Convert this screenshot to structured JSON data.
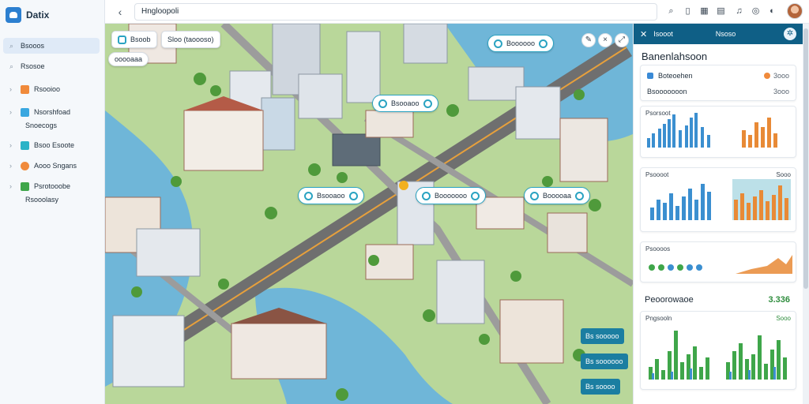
{
  "app": {
    "name": "Datix"
  },
  "topbar": {
    "address": "Hngloopoli",
    "back": "‹"
  },
  "sidebar": {
    "items": [
      {
        "label": "Bsooos",
        "icon": "search-icon",
        "active": true
      },
      {
        "label": "Rsosoe",
        "icon": "search-icon",
        "active": false
      },
      {
        "label": "Rsooioo",
        "icon": "cube-icon",
        "active": false
      },
      {
        "label": "Nsorshfoad",
        "sub": "Snoecogs",
        "icon": "stack-icon",
        "active": false
      },
      {
        "label": "Bsoo Esoote",
        "icon": "panel-icon",
        "active": false
      },
      {
        "label": "Aooo Sngans",
        "icon": "gauge-icon",
        "active": false
      },
      {
        "label": "Psrotooobe",
        "sub": "Rsooolasy",
        "icon": "layers-icon",
        "active": false
      }
    ]
  },
  "map": {
    "toolbar": {
      "filter_label": "Bsoob",
      "search_chip": "Sloo (taoooso)"
    },
    "top_tag": "ooooaaa",
    "callouts": [
      {
        "label": "Boooooo"
      },
      {
        "label": "Bsooaoo"
      },
      {
        "label": "Bsooaoo"
      },
      {
        "label": "Booooooo"
      },
      {
        "label": "Booooaa"
      }
    ],
    "side_chips": [
      "Bs sooooo",
      "Bs soooooo",
      "Bs soooo"
    ]
  },
  "panel": {
    "header": {
      "left": "Isooot",
      "center": "Nsoso"
    },
    "title": "Banenlahsoon",
    "row1": {
      "label": "Boteoehen",
      "value": "3ooo"
    },
    "row2": {
      "label": "Bsooooooon",
      "value": "3ooo"
    },
    "chart1": {
      "title": "Psorsoot"
    },
    "chart2": {
      "title": "Psoooot",
      "value": "Sooo"
    },
    "chart3": {
      "title": "Psoooos"
    },
    "section": {
      "title": "Peoorowaoe",
      "value": "3.336"
    },
    "chart4": {
      "title": "Pngsooln",
      "tag": "Sooo"
    }
  },
  "colors": {
    "accent": "#0f5f86",
    "brand": "#2c7fd0",
    "water": "#6fb6d8",
    "road": "#8a8a8a",
    "bar_blue": "#3b8fd0",
    "bar_orange": "#e88a36",
    "bar_green": "#3fa64a"
  }
}
